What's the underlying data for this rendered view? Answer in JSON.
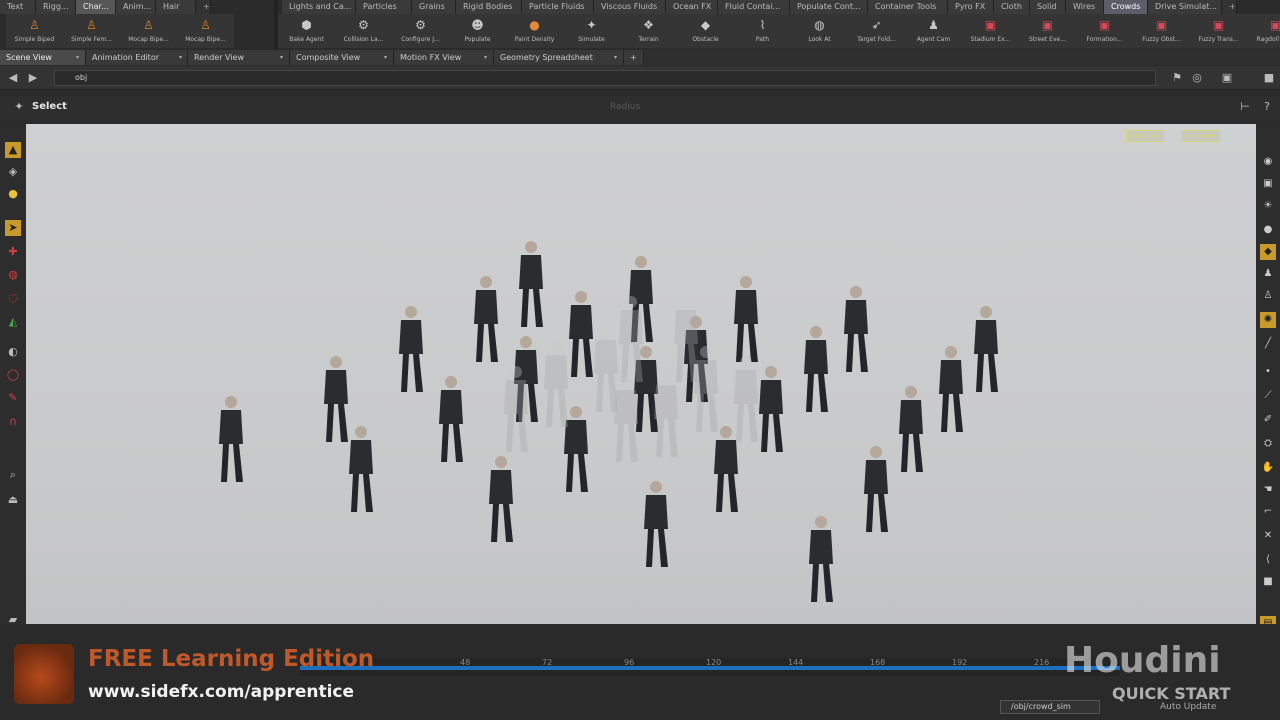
{
  "shelf_tabs_left": [
    {
      "label": "Text",
      "width": 36
    },
    {
      "label": "Rigg...",
      "width": 40
    },
    {
      "label": "Char...",
      "width": 40,
      "active": true
    },
    {
      "label": "Anim...",
      "width": 40
    },
    {
      "label": "Hair",
      "width": 40
    }
  ],
  "shelf_tabs_right": [
    {
      "label": "Lights and Ca...",
      "width": 74
    },
    {
      "label": "Particles",
      "width": 56
    },
    {
      "label": "Grains",
      "width": 44
    },
    {
      "label": "Rigid Bodies",
      "width": 66
    },
    {
      "label": "Particle Fluids",
      "width": 72
    },
    {
      "label": "Viscous Fluids",
      "width": 72
    },
    {
      "label": "Ocean FX",
      "width": 52
    },
    {
      "label": "Fluid Contai...",
      "width": 72
    },
    {
      "label": "Populate Cont...",
      "width": 78
    },
    {
      "label": "Container Tools",
      "width": 80
    },
    {
      "label": "Pyro FX",
      "width": 46
    },
    {
      "label": "Cloth",
      "width": 36
    },
    {
      "label": "Solid",
      "width": 36
    },
    {
      "label": "Wires",
      "width": 38
    },
    {
      "label": "Crowds",
      "width": 44,
      "crowds": true
    },
    {
      "label": "Drive Simulat...",
      "width": 74
    }
  ],
  "shelf_tools_left": [
    "Simple Biped",
    "Simple Fem...",
    "Mocap Bipe...",
    "Mocap Bipe..."
  ],
  "shelf_tools_right": [
    "Bake Agent",
    "Collision La...",
    "Configure J...",
    "Populate",
    "Paint Density",
    "Simulate",
    "Terrain",
    "Obstacle",
    "Path",
    "Look At",
    "Target Fold...",
    "Agent Cam",
    "Stadium Ex...",
    "Street Eve...",
    "Formation...",
    "Fuzzy Obst...",
    "Fuzzy Trans...",
    "Ragdoll Ru..."
  ],
  "pane_tabs": [
    {
      "label": "Scene View",
      "active": true
    },
    {
      "label": "Animation Editor"
    },
    {
      "label": "Render View"
    },
    {
      "label": "Composite View"
    },
    {
      "label": "Motion FX View"
    },
    {
      "label": "Geometry Spreadsheet"
    }
  ],
  "path": "obj",
  "operation": {
    "title": "Select",
    "radius_label": "Radius"
  },
  "viewport": {
    "camera_menu": "persp1",
    "cam_menu": "no cam"
  },
  "timeline_ticks": [
    "48",
    "72",
    "96",
    "120",
    "144",
    "168",
    "192",
    "216"
  ],
  "watermark": {
    "free_edition": "FREE Learning Edition",
    "url": "www.sidefx.com/apprentice",
    "brand": "Houdini",
    "subtitle": "QUICK START"
  },
  "status_node": "/obj/crowd_sim",
  "auto_update": "Auto Update",
  "colors": {
    "crowds_tab": "#5d5d6a",
    "viewport_bg": "#cfd0d1",
    "timeline_blue": "#1f6fbf",
    "watermark_orange": "#d9622a"
  },
  "icons": {
    "plus": "+",
    "back": "◀",
    "forward": "▶",
    "dropdown": "▾"
  }
}
